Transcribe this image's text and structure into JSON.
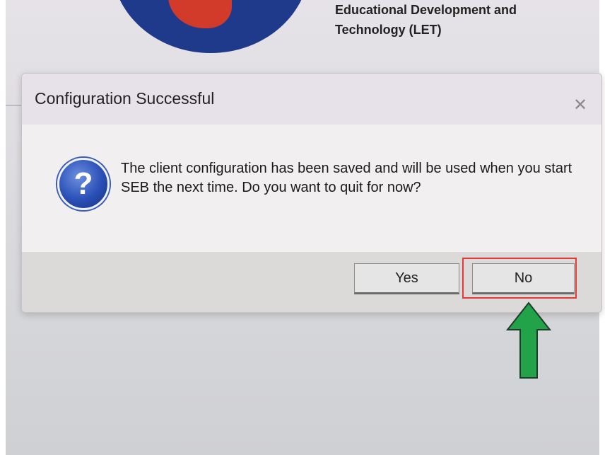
{
  "header": {
    "org_line1": "Educational Development and",
    "org_line2": "Technology (LET)"
  },
  "dialog": {
    "title": "Configuration Successful",
    "close_glyph": "✕",
    "icon": "question-icon",
    "icon_glyph": "?",
    "message": "The client configuration has been saved and will be used when you start SEB the next time. Do you want to quit for now?",
    "buttons": {
      "yes_label": "Yes",
      "no_label": "No"
    }
  },
  "annotations": {
    "highlight_color": "#e53935",
    "arrow_color": "#22a34a",
    "arrow_icon": "up-arrow-icon"
  }
}
